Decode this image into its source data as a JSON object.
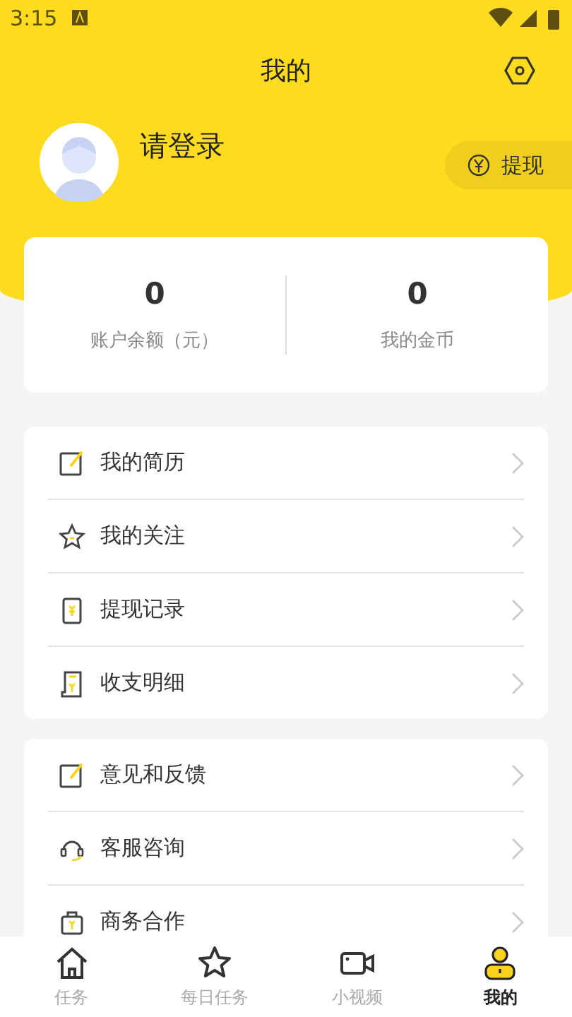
{
  "status_bar": {
    "time": "3:15"
  },
  "header": {
    "title": "我的"
  },
  "profile": {
    "name": "请登录",
    "withdraw_button": "提现"
  },
  "stats": [
    {
      "value": "0",
      "label": "账户余额（元）"
    },
    {
      "value": "0",
      "label": "我的金币"
    }
  ],
  "menu_groups": [
    [
      {
        "kind": "edit",
        "label": "我的简历"
      },
      {
        "kind": "star",
        "label": "我的关注"
      },
      {
        "kind": "record",
        "label": "提现记录"
      },
      {
        "kind": "bill",
        "label": "收支明细"
      }
    ],
    [
      {
        "kind": "edit",
        "label": "意见和反馈"
      },
      {
        "kind": "headset",
        "label": "客服咨询"
      },
      {
        "kind": "bag",
        "label": "商务合作"
      }
    ]
  ],
  "tab_bar": [
    {
      "kind": "home",
      "label": "任务",
      "selected": false
    },
    {
      "kind": "star",
      "label": "每日任务",
      "selected": false
    },
    {
      "kind": "video",
      "label": "小视频",
      "selected": false
    },
    {
      "kind": "user",
      "label": "我的",
      "selected": true
    }
  ]
}
